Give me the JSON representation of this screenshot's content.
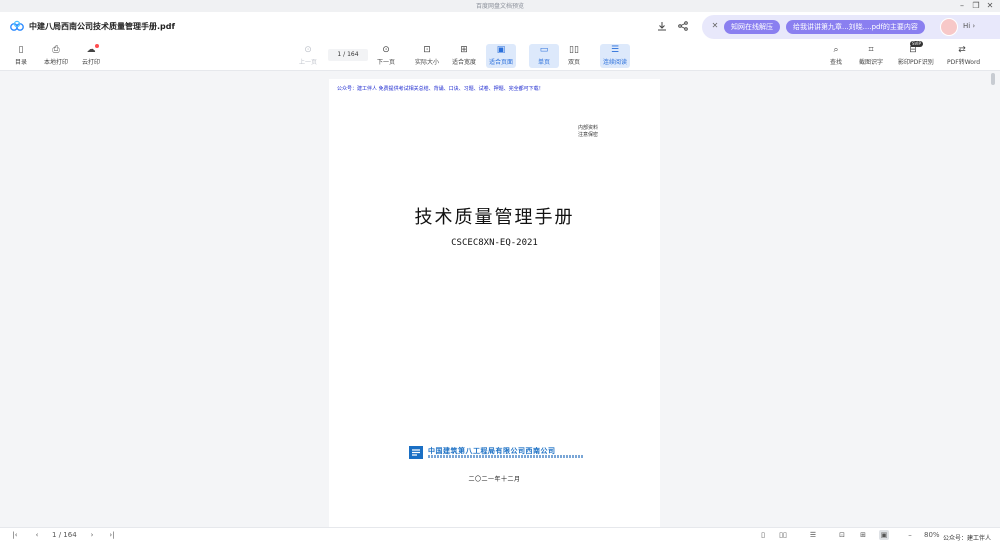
{
  "window": {
    "title": "百度网盘文档预览",
    "minimize": "–",
    "restore": "❐",
    "close": "✕"
  },
  "header": {
    "doc_title": "中建八局西南公司技术质量管理手册.pdf",
    "ai_suggestions": [
      "知网在线解压",
      "给我讲讲第九章...刘晓....pdf的主要内容"
    ],
    "ai_greeting": "Hi ›"
  },
  "toolbar": {
    "left": [
      {
        "label": "目录",
        "icon": "sidebar-icon"
      },
      {
        "label": "本地打印",
        "icon": "print-icon"
      },
      {
        "label": "云打印",
        "icon": "cloud-print-icon"
      }
    ],
    "prev_label": "上一页",
    "page_value": "1",
    "page_total": "/ 164",
    "next_label": "下一页",
    "view": [
      {
        "label": "实际大小",
        "icon": "actual-size-icon"
      },
      {
        "label": "适合宽度",
        "icon": "fit-width-icon"
      },
      {
        "label": "适合页面",
        "icon": "fit-page-icon"
      },
      {
        "label": "单页",
        "icon": "single-page-icon"
      },
      {
        "label": "双页",
        "icon": "double-page-icon"
      },
      {
        "label": "连续阅读",
        "icon": "continuous-icon"
      }
    ],
    "right": [
      {
        "label": "查找",
        "icon": "search-icon"
      },
      {
        "label": "截图识字",
        "icon": "screenshot-ocr-icon"
      },
      {
        "label": "影印PDF识别",
        "icon": "scan-pdf-icon"
      },
      {
        "label": "PDF转Word",
        "icon": "pdf-to-word-icon"
      }
    ],
    "svip_badge": "SVIP"
  },
  "document": {
    "public_account_line": "公众号：建工伴人 免费提供考试相关总结、背诵、口诀、习题、试卷、押题、完全都可下载！",
    "internal_note": [
      "内部资料",
      "注意保密"
    ],
    "main_title": "技术质量管理手册",
    "code": "CSCEC8XN-EQ-2021",
    "company_name": "中国建筑第八工程局有限公司西南公司",
    "date": "二〇二一年十二月"
  },
  "statusbar": {
    "page_value": "1",
    "page_total": "/ 164",
    "zoom": "80%",
    "watermark": "公众号：建工伴人"
  }
}
